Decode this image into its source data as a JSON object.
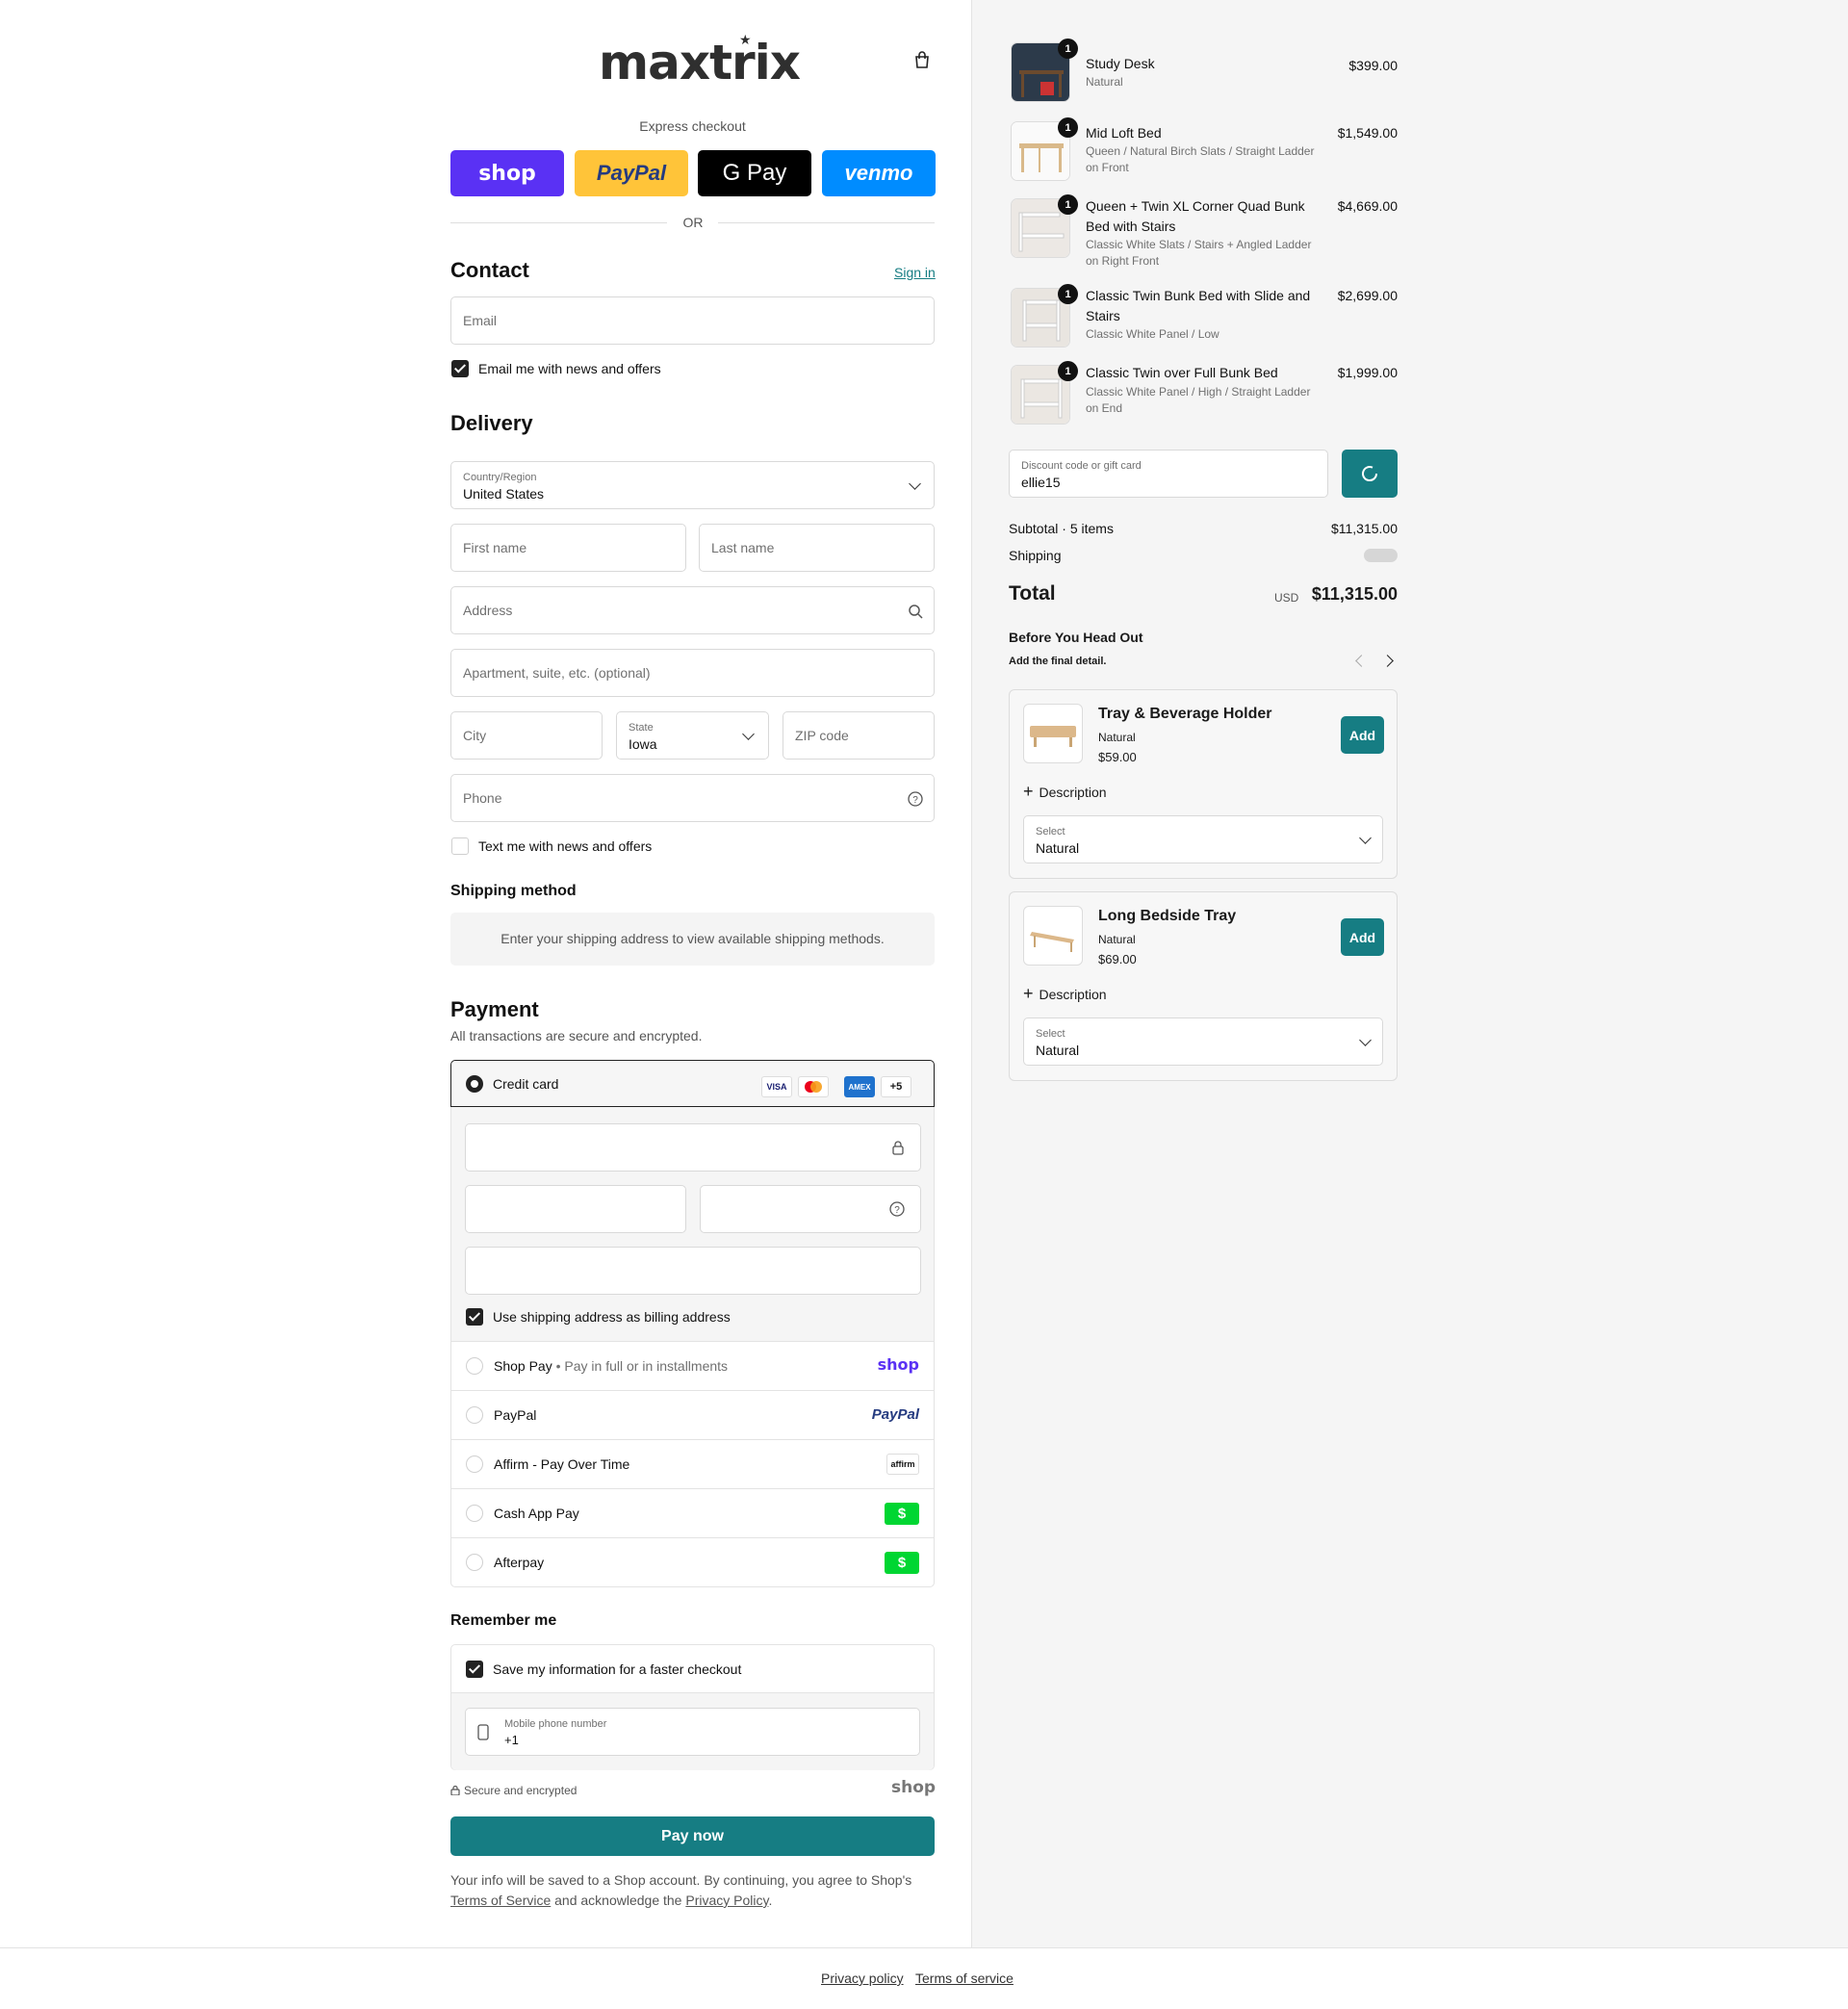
{
  "brand": {
    "logo": "maxtrix",
    "logo_mark": "★"
  },
  "express": {
    "label": "Express checkout",
    "shop": "shop",
    "paypal": "PayPal",
    "gpay": "G Pay",
    "venmo": "venmo",
    "or": "OR"
  },
  "contact": {
    "title": "Contact",
    "sign_in": "Sign in",
    "email_placeholder": "Email",
    "news_label": "Email me with news and offers",
    "news_checked": true
  },
  "delivery": {
    "title": "Delivery",
    "country_label": "Country/Region",
    "country_value": "United States",
    "first_name": "First name",
    "last_name": "Last name",
    "address": "Address",
    "apartment": "Apartment, suite, etc. (optional)",
    "city": "City",
    "state_label": "State",
    "state_value": "Iowa",
    "zip": "ZIP code",
    "phone": "Phone",
    "text_label": "Text me with news and offers",
    "text_checked": false
  },
  "shipping": {
    "title": "Shipping method",
    "message": "Enter your shipping address to view available shipping methods."
  },
  "payment": {
    "title": "Payment",
    "subtitle": "All transactions are secure and encrypted.",
    "credit_card": "Credit card",
    "card_brands": [
      "VISA",
      "MC",
      "AMEX"
    ],
    "more_brands": "+5",
    "billing_label": "Use shipping address as billing address",
    "options": [
      {
        "name": "Shop Pay",
        "detail": "Pay in full or in installments",
        "logo": "shop"
      },
      {
        "name": "PayPal",
        "detail": "",
        "logo": "PayPal"
      },
      {
        "name": "Affirm - Pay Over Time",
        "detail": "",
        "logo": "affirm"
      },
      {
        "name": "Cash App Pay",
        "detail": "",
        "logo": "$"
      },
      {
        "name": "Afterpay",
        "detail": "",
        "logo": "$"
      }
    ]
  },
  "remember": {
    "title": "Remember me",
    "save_label": "Save my information for a faster checkout",
    "phone_label": "Mobile phone number",
    "phone_value": "+1",
    "secure": "Secure and encrypted",
    "shop": "shop"
  },
  "pay_now": "Pay now",
  "legal": {
    "prefix": "Your info will be saved to a Shop account. By continuing, you agree to Shop's",
    "tos": "Terms of Service",
    "middle": "and acknowledge the",
    "privacy": "Privacy Policy",
    "end": "."
  },
  "cart": {
    "items": [
      {
        "title": "Study Desk",
        "variant": "Natural",
        "price": "$399.00",
        "qty": "1"
      },
      {
        "title": "Mid Loft Bed",
        "variant": "Queen / Natural Birch Slats / Straight Ladder on Front",
        "price": "$1,549.00",
        "qty": "1"
      },
      {
        "title": "Queen + Twin XL Corner Quad Bunk Bed with Stairs",
        "variant": "Classic White Slats / Stairs + Angled Ladder on Right Front",
        "price": "$4,669.00",
        "qty": "1"
      },
      {
        "title": "Classic Twin Bunk Bed with Slide and Stairs",
        "variant": "Classic White Panel / Low",
        "price": "$2,699.00",
        "qty": "1"
      },
      {
        "title": "Classic Twin over Full Bunk Bed",
        "variant": "Classic White Panel / High / Straight Ladder on End",
        "price": "$1,999.00",
        "qty": "1"
      }
    ]
  },
  "discount": {
    "label": "Discount code or gift card",
    "value": "ellie15"
  },
  "summary": {
    "subtotal_label": "Subtotal · 5 items",
    "subtotal": "$11,315.00",
    "shipping_label": "Shipping",
    "total_label": "Total",
    "currency": "USD",
    "total": "$11,315.00"
  },
  "upsell": {
    "title": "Before You Head Out",
    "subtitle": "Add the final detail.",
    "products": [
      {
        "name": "Tray & Beverage Holder",
        "variant": "Natural",
        "price": "$59.00",
        "add": "Add",
        "description": "Description",
        "select_label": "Select",
        "select_value": "Natural"
      },
      {
        "name": "Long Bedside Tray",
        "variant": "Natural",
        "price": "$69.00",
        "add": "Add",
        "description": "Description",
        "select_label": "Select",
        "select_value": "Natural"
      }
    ]
  },
  "footer": {
    "privacy": "Privacy policy",
    "terms": "Terms of service"
  },
  "colors": {
    "accent": "#167d83",
    "shop": "#5a31f4",
    "paypal": "#ffc439",
    "venmo": "#008cff"
  }
}
